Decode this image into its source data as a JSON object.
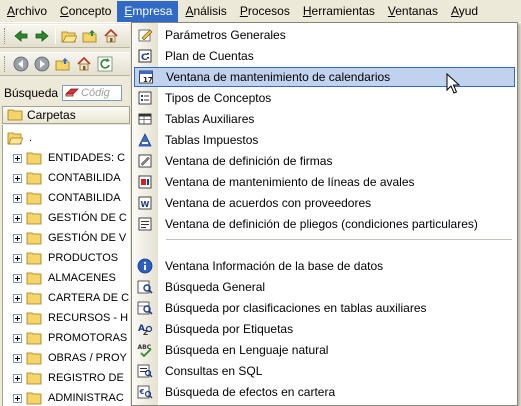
{
  "menubar": {
    "items": [
      {
        "label": "Archivo",
        "key": "A",
        "rest": "rchivo"
      },
      {
        "label": "Concepto",
        "key": "C",
        "rest": "oncepto"
      },
      {
        "label": "Empresa",
        "key": "E",
        "rest": "mpresa"
      },
      {
        "label": "Análisis",
        "key": "A",
        "rest": "nálisis"
      },
      {
        "label": "Procesos",
        "key": "P",
        "rest": "rocesos"
      },
      {
        "label": "Herramientas",
        "key": "H",
        "rest": "erramientas"
      },
      {
        "label": "Ventanas",
        "key": "V",
        "rest": "entanas"
      },
      {
        "label": "Ayud",
        "key": "A",
        "rest": "yud"
      }
    ]
  },
  "search": {
    "label": "Búsqueda",
    "placeholder": "Códig"
  },
  "tree": {
    "header": "Carpetas",
    "root": ".",
    "items": [
      "ENTIDADES: C",
      "CONTABILIDA",
      "CONTABILIDA",
      "GESTIÓN DE C",
      "GESTIÓN DE V",
      "PRODUCTOS",
      "ALMACENES",
      "CARTERA DE C",
      "RECURSOS - H",
      "PROMOTORAS",
      "OBRAS / PROY",
      "REGISTRO DE",
      "ADMINISTRAC"
    ]
  },
  "menu": {
    "group1": [
      {
        "label": "Parámetros Generales",
        "icon": "edit-icon"
      },
      {
        "label": "Plan de Cuentas",
        "icon": "accounts-icon"
      },
      {
        "label": "Ventana de mantenimiento de calendarios",
        "icon": "calendar-icon",
        "highlighted": true
      },
      {
        "label": "Tipos de Conceptos",
        "icon": "list-icon"
      },
      {
        "label": "Tablas Auxiliares",
        "icon": "table-icon"
      },
      {
        "label": "Tablas Impuestos",
        "icon": "tax-icon"
      },
      {
        "label": "Ventana de definición de firmas",
        "icon": "signature-icon"
      },
      {
        "label": "Ventana de mantenimiento de líneas de avales",
        "icon": "guarantee-icon"
      },
      {
        "label": "Ventana de acuerdos con proveedores",
        "icon": "agreement-icon"
      },
      {
        "label": "Ventana de definición de pliegos (condiciones particulares)",
        "icon": "document-icon"
      }
    ],
    "group2": [
      {
        "label": "Ventana Información de la base de datos",
        "icon": "info-icon"
      },
      {
        "label": "Búsqueda General",
        "icon": "search-icon"
      },
      {
        "label": "Búsqueda por clasificaciones en tablas auxiliares",
        "icon": "search-table-icon"
      },
      {
        "label": "Búsqueda por Etiquetas",
        "icon": "tag-icon"
      },
      {
        "label": "Búsqueda en Lenguaje natural",
        "icon": "abc-icon"
      },
      {
        "label": "Consultas en SQL",
        "icon": "sql-icon"
      },
      {
        "label": "Búsqueda de efectos en cartera",
        "icon": "portfolio-icon"
      }
    ]
  },
  "colors": {
    "highlight_bg": "#c1d2ee",
    "highlight_border": "#316ac5",
    "menubar_active": "#316ac5"
  }
}
